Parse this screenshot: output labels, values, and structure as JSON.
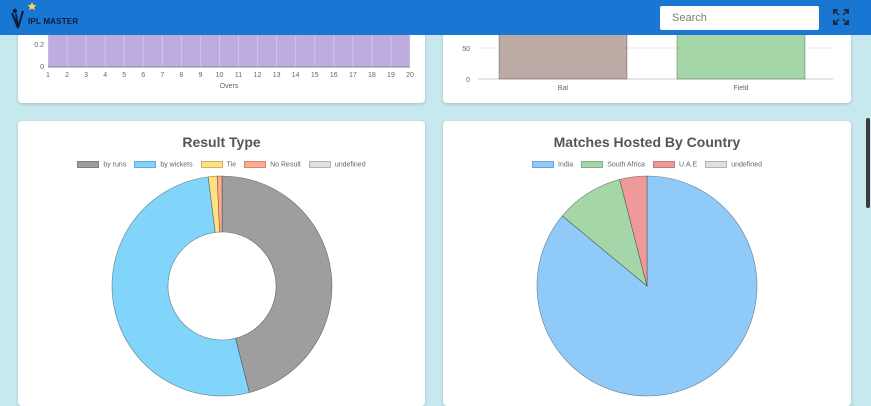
{
  "navbar": {
    "logo_text": "IPL MASTER",
    "search_placeholder": "Search",
    "accent_color": "#1976d2"
  },
  "overs_chart": {
    "chart_data": {
      "type": "bar",
      "categories": [
        "1",
        "2",
        "3",
        "4",
        "5",
        "6",
        "7",
        "8",
        "9",
        "10",
        "11",
        "12",
        "13",
        "14",
        "15",
        "16",
        "17",
        "18",
        "19",
        "20"
      ],
      "xlabel": "Overs",
      "ytick_labels": [
        "0.2",
        "0"
      ],
      "color": "#b39ddb"
    }
  },
  "toss_chart": {
    "chart_data": {
      "type": "bar",
      "categories": [
        "Bat",
        "Field"
      ],
      "ytick_labels": [
        "50",
        "0"
      ],
      "colors": [
        "#bcaaa4",
        "#a5d6a7"
      ]
    }
  },
  "result_type": {
    "title": "Result Type",
    "chart_data": {
      "type": "pie",
      "variant": "doughnut",
      "labels": [
        "by runs",
        "by wickets",
        "Tie",
        "No Result",
        "undefined"
      ],
      "values": [
        46,
        52,
        1.3,
        0.7,
        0
      ],
      "colors": [
        "#9e9e9e",
        "#81d4fa",
        "#ffe082",
        "#ffab91",
        "#e0e0e0"
      ]
    }
  },
  "matches_hosted": {
    "title": "Matches Hosted By Country",
    "chart_data": {
      "type": "pie",
      "labels": [
        "India",
        "South Africa",
        "U.A.E",
        "undefined"
      ],
      "values": [
        86,
        10,
        4,
        0
      ],
      "colors": [
        "#90caf9",
        "#a5d6a7",
        "#ef9a9a",
        "#e0e0e0"
      ]
    }
  }
}
